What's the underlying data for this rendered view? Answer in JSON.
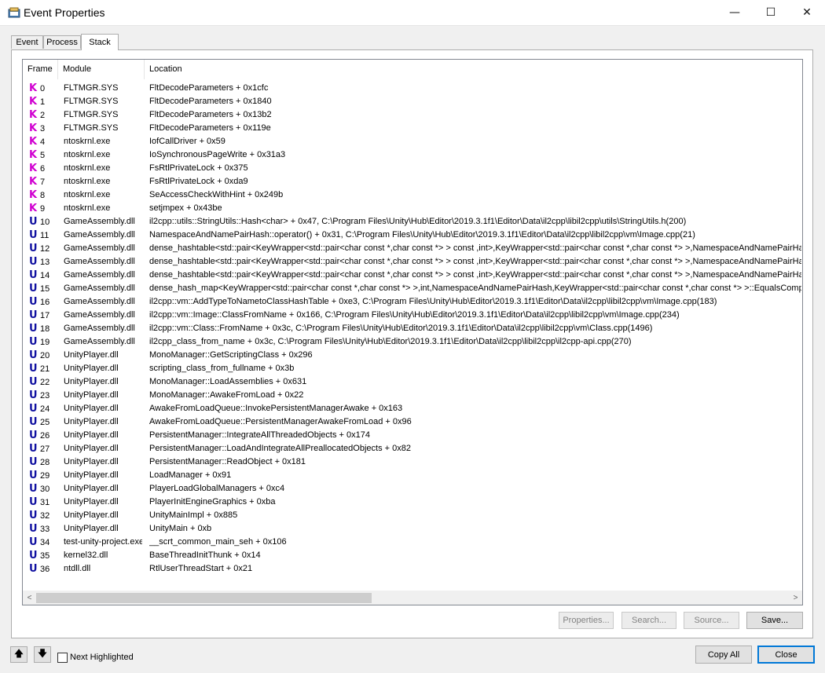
{
  "window": {
    "title": "Event Properties",
    "minimize_glyph": "—",
    "maximize_glyph": "☐",
    "close_glyph": "✕"
  },
  "tabs": [
    {
      "label": "Event",
      "active": false
    },
    {
      "label": "Process",
      "active": false
    },
    {
      "label": "Stack",
      "active": true
    }
  ],
  "table": {
    "columns": [
      "Frame",
      "Module",
      "Location"
    ],
    "rows": [
      {
        "kind": "K",
        "frame": "0",
        "module": "FLTMGR.SYS",
        "location": "FltDecodeParameters + 0x1cfc"
      },
      {
        "kind": "K",
        "frame": "1",
        "module": "FLTMGR.SYS",
        "location": "FltDecodeParameters + 0x1840"
      },
      {
        "kind": "K",
        "frame": "2",
        "module": "FLTMGR.SYS",
        "location": "FltDecodeParameters + 0x13b2"
      },
      {
        "kind": "K",
        "frame": "3",
        "module": "FLTMGR.SYS",
        "location": "FltDecodeParameters + 0x119e"
      },
      {
        "kind": "K",
        "frame": "4",
        "module": "ntoskrnl.exe",
        "location": "IofCallDriver + 0x59"
      },
      {
        "kind": "K",
        "frame": "5",
        "module": "ntoskrnl.exe",
        "location": "IoSynchronousPageWrite + 0x31a3"
      },
      {
        "kind": "K",
        "frame": "6",
        "module": "ntoskrnl.exe",
        "location": "FsRtlPrivateLock + 0x375"
      },
      {
        "kind": "K",
        "frame": "7",
        "module": "ntoskrnl.exe",
        "location": "FsRtlPrivateLock + 0xda9"
      },
      {
        "kind": "K",
        "frame": "8",
        "module": "ntoskrnl.exe",
        "location": "SeAccessCheckWithHint + 0x249b"
      },
      {
        "kind": "K",
        "frame": "9",
        "module": "ntoskrnl.exe",
        "location": "setjmpex + 0x43be"
      },
      {
        "kind": "U",
        "frame": "10",
        "module": "GameAssembly.dll",
        "location": "il2cpp::utils::StringUtils::Hash<char> + 0x47, C:\\Program Files\\Unity\\Hub\\Editor\\2019.3.1f1\\Editor\\Data\\il2cpp\\libil2cpp\\utils\\StringUtils.h(200)"
      },
      {
        "kind": "U",
        "frame": "11",
        "module": "GameAssembly.dll",
        "location": "NamespaceAndNamePairHash::operator() + 0x31, C:\\Program Files\\Unity\\Hub\\Editor\\2019.3.1f1\\Editor\\Data\\il2cpp\\libil2cpp\\vm\\Image.cpp(21)"
      },
      {
        "kind": "U",
        "frame": "12",
        "module": "GameAssembly.dll",
        "location": "dense_hashtable<std::pair<KeyWrapper<std::pair<char const *,char const *> > const ,int>,KeyWrapper<std::pair<char const *,char const *> >,NamespaceAndNamePairHash,den"
      },
      {
        "kind": "U",
        "frame": "13",
        "module": "GameAssembly.dll",
        "location": "dense_hashtable<std::pair<KeyWrapper<std::pair<char const *,char const *> > const ,int>,KeyWrapper<std::pair<char const *,char const *> >,NamespaceAndNamePairHash,den"
      },
      {
        "kind": "U",
        "frame": "14",
        "module": "GameAssembly.dll",
        "location": "dense_hashtable<std::pair<KeyWrapper<std::pair<char const *,char const *> > const ,int>,KeyWrapper<std::pair<char const *,char const *> >,NamespaceAndNamePairHash,den"
      },
      {
        "kind": "U",
        "frame": "15",
        "module": "GameAssembly.dll",
        "location": "dense_hash_map<KeyWrapper<std::pair<char const *,char const *> >,int,NamespaceAndNamePairHash,KeyWrapper<std::pair<char const *,char const *> >::EqualsComparer<N"
      },
      {
        "kind": "U",
        "frame": "16",
        "module": "GameAssembly.dll",
        "location": "il2cpp::vm::AddTypeToNametoClassHashTable + 0xe3, C:\\Program Files\\Unity\\Hub\\Editor\\2019.3.1f1\\Editor\\Data\\il2cpp\\libil2cpp\\vm\\Image.cpp(183)"
      },
      {
        "kind": "U",
        "frame": "17",
        "module": "GameAssembly.dll",
        "location": "il2cpp::vm::Image::ClassFromName + 0x166, C:\\Program Files\\Unity\\Hub\\Editor\\2019.3.1f1\\Editor\\Data\\il2cpp\\libil2cpp\\vm\\Image.cpp(234)"
      },
      {
        "kind": "U",
        "frame": "18",
        "module": "GameAssembly.dll",
        "location": "il2cpp::vm::Class::FromName + 0x3c, C:\\Program Files\\Unity\\Hub\\Editor\\2019.3.1f1\\Editor\\Data\\il2cpp\\libil2cpp\\vm\\Class.cpp(1496)"
      },
      {
        "kind": "U",
        "frame": "19",
        "module": "GameAssembly.dll",
        "location": "il2cpp_class_from_name + 0x3c, C:\\Program Files\\Unity\\Hub\\Editor\\2019.3.1f1\\Editor\\Data\\il2cpp\\libil2cpp\\il2cpp-api.cpp(270)"
      },
      {
        "kind": "U",
        "frame": "20",
        "module": "UnityPlayer.dll",
        "location": "MonoManager::GetScriptingClass + 0x296"
      },
      {
        "kind": "U",
        "frame": "21",
        "module": "UnityPlayer.dll",
        "location": "scripting_class_from_fullname + 0x3b"
      },
      {
        "kind": "U",
        "frame": "22",
        "module": "UnityPlayer.dll",
        "location": "MonoManager::LoadAssemblies + 0x631"
      },
      {
        "kind": "U",
        "frame": "23",
        "module": "UnityPlayer.dll",
        "location": "MonoManager::AwakeFromLoad + 0x22"
      },
      {
        "kind": "U",
        "frame": "24",
        "module": "UnityPlayer.dll",
        "location": "AwakeFromLoadQueue::InvokePersistentManagerAwake + 0x163"
      },
      {
        "kind": "U",
        "frame": "25",
        "module": "UnityPlayer.dll",
        "location": "AwakeFromLoadQueue::PersistentManagerAwakeFromLoad + 0x96"
      },
      {
        "kind": "U",
        "frame": "26",
        "module": "UnityPlayer.dll",
        "location": "PersistentManager::IntegrateAllThreadedObjects + 0x174"
      },
      {
        "kind": "U",
        "frame": "27",
        "module": "UnityPlayer.dll",
        "location": "PersistentManager::LoadAndIntegrateAllPreallocatedObjects + 0x82"
      },
      {
        "kind": "U",
        "frame": "28",
        "module": "UnityPlayer.dll",
        "location": "PersistentManager::ReadObject + 0x181"
      },
      {
        "kind": "U",
        "frame": "29",
        "module": "UnityPlayer.dll",
        "location": "LoadManager + 0x91"
      },
      {
        "kind": "U",
        "frame": "30",
        "module": "UnityPlayer.dll",
        "location": "PlayerLoadGlobalManagers + 0xc4"
      },
      {
        "kind": "U",
        "frame": "31",
        "module": "UnityPlayer.dll",
        "location": "PlayerInitEngineGraphics + 0xba"
      },
      {
        "kind": "U",
        "frame": "32",
        "module": "UnityPlayer.dll",
        "location": "UnityMainImpl + 0x885"
      },
      {
        "kind": "U",
        "frame": "33",
        "module": "UnityPlayer.dll",
        "location": "UnityMain + 0xb"
      },
      {
        "kind": "U",
        "frame": "34",
        "module": "test-unity-project.exe",
        "location": "__scrt_common_main_seh + 0x106"
      },
      {
        "kind": "U",
        "frame": "35",
        "module": "kernel32.dll",
        "location": "BaseThreadInitThunk + 0x14"
      },
      {
        "kind": "U",
        "frame": "36",
        "module": "ntdll.dll",
        "location": "RtlUserThreadStart + 0x21"
      }
    ]
  },
  "scrollbar": {
    "left_glyph": "<",
    "right_glyph": ">"
  },
  "panel_buttons": {
    "properties": "Properties...",
    "search": "Search...",
    "source": "Source...",
    "save": "Save..."
  },
  "footer": {
    "up_glyph": "🡅",
    "down_glyph": "🡇",
    "next_highlighted": "Next Highlighted",
    "copy_all": "Copy All",
    "close": "Close"
  },
  "colors": {
    "kernel_marker": "#d000d0",
    "user_marker": "#1010a0",
    "focus_border": "#0078d7"
  }
}
